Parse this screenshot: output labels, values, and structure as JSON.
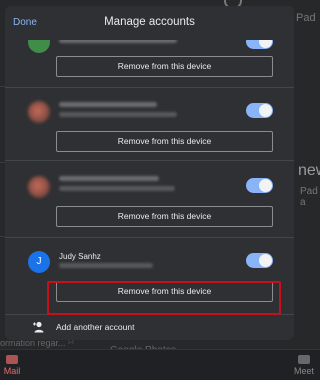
{
  "modal": {
    "done_label": "Done",
    "title": "Manage accounts"
  },
  "accounts": [
    {
      "name": "",
      "toggle_on": true,
      "remove_label": "Remove from this device"
    },
    {
      "name": "",
      "toggle_on": true,
      "remove_label": "Remove from this device"
    },
    {
      "name": "",
      "toggle_on": true,
      "remove_label": "Remove from this device"
    },
    {
      "name": "Judy Sanhz",
      "avatar_letter": "J",
      "toggle_on": true,
      "remove_label": "Remove from this device"
    }
  ],
  "add_account_label": "Add another account",
  "background": {
    "side_text_top": "Pad",
    "side_text_mid": "new",
    "side_text_mid2": "Pad a",
    "info_text": "ormation regar...",
    "photos_text": "Google Photos",
    "tab_mail": "Mail",
    "tab_meet": "Meet"
  },
  "colors": {
    "accent": "#8ab4f8",
    "highlight": "#c8101d",
    "avatar": "#1a73e8"
  }
}
